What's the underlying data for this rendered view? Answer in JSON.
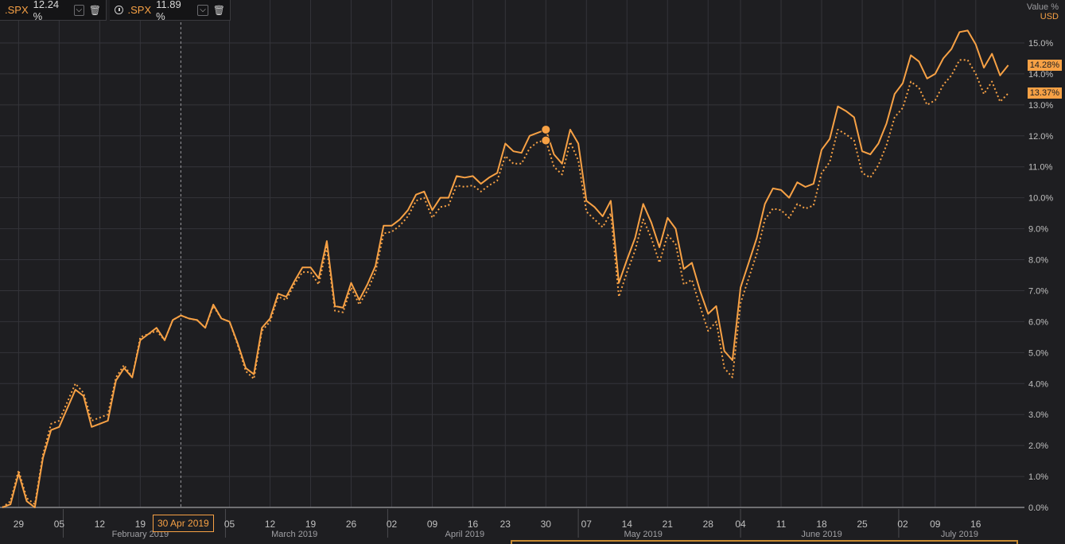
{
  "legend": [
    {
      "symbol": ".SPX",
      "value": "12.24 %",
      "clock": false
    },
    {
      "symbol": ".SPX",
      "value": "11.89 %",
      "clock": true
    }
  ],
  "axis": {
    "title": "Value %",
    "currency": "USD"
  },
  "tags": {
    "solid": "14.28%",
    "dotted": "13.37%"
  },
  "crosshair_date": "30 Apr 2019",
  "colors": {
    "line": "#f7a145",
    "background": "#1e1e21",
    "grid": "#34343a",
    "text": "#c0c0c0"
  },
  "chart_data": {
    "type": "line",
    "ylim": [
      0,
      16
    ],
    "yticks": [
      0,
      1,
      2,
      3,
      4,
      5,
      6,
      7,
      8,
      9,
      10,
      11,
      12,
      13,
      14,
      15
    ],
    "ytick_labels": [
      "0.0%",
      "1.0%",
      "2.0%",
      "3.0%",
      "4.0%",
      "5.0%",
      "6.0%",
      "7.0%",
      "8.0%",
      "9.0%",
      "10.0%",
      "11.0%",
      "12.0%",
      "13.0%",
      "14.0%",
      "15.0%"
    ],
    "xlim": [
      0,
      126
    ],
    "xticks": [
      {
        "i": 2,
        "label": "29"
      },
      {
        "i": 7,
        "label": "05"
      },
      {
        "i": 12,
        "label": "12"
      },
      {
        "i": 17,
        "label": "19"
      },
      {
        "i": 28,
        "label": "05"
      },
      {
        "i": 33,
        "label": "12"
      },
      {
        "i": 38,
        "label": "19"
      },
      {
        "i": 43,
        "label": "26"
      },
      {
        "i": 48,
        "label": "02"
      },
      {
        "i": 53,
        "label": "09"
      },
      {
        "i": 58,
        "label": "16"
      },
      {
        "i": 62,
        "label": "23"
      },
      {
        "i": 67,
        "label": "30"
      },
      {
        "i": 72,
        "label": "07"
      },
      {
        "i": 77,
        "label": "14"
      },
      {
        "i": 82,
        "label": "21"
      },
      {
        "i": 87,
        "label": "28"
      },
      {
        "i": 91,
        "label": "04"
      },
      {
        "i": 96,
        "label": "11"
      },
      {
        "i": 101,
        "label": "18"
      },
      {
        "i": 106,
        "label": "25"
      },
      {
        "i": 111,
        "label": "02"
      },
      {
        "i": 115,
        "label": "09"
      },
      {
        "i": 120,
        "label": "16"
      }
    ],
    "months": [
      {
        "label": "February 2019",
        "i": 17
      },
      {
        "label": "March 2019",
        "i": 36
      },
      {
        "label": "April 2019",
        "i": 57
      },
      {
        "label": "May 2019",
        "i": 79
      },
      {
        "label": "June 2019",
        "i": 101
      },
      {
        "label": "July 2019",
        "i": 118
      }
    ],
    "month_separators": [
      7.5,
      27.5,
      47.5,
      71,
      91,
      110.5
    ],
    "crosshair_index": 22,
    "marker_index": 67,
    "series": [
      {
        "style": "solid",
        "values": [
          0,
          0.1,
          1.1,
          0.2,
          0,
          1.6,
          2.5,
          2.6,
          3.2,
          3.8,
          3.6,
          2.6,
          2.7,
          2.8,
          4.1,
          4.5,
          4.2,
          5.4,
          5.6,
          5.8,
          5.4,
          6.05,
          6.2,
          6.1,
          6.05,
          5.8,
          6.55,
          6.1,
          6.0,
          5.3,
          4.5,
          4.3,
          5.8,
          6.1,
          6.9,
          6.8,
          7.3,
          7.75,
          7.75,
          7.4,
          8.6,
          6.5,
          6.45,
          7.25,
          6.7,
          7.2,
          7.8,
          9.1,
          9.1,
          9.3,
          9.6,
          10.1,
          10.2,
          9.6,
          10.0,
          10.0,
          10.7,
          10.65,
          10.7,
          10.45,
          10.65,
          10.8,
          11.75,
          11.5,
          11.45,
          12.0,
          12.1,
          12.2,
          11.4,
          11.1,
          12.2,
          11.75,
          9.9,
          9.7,
          9.4,
          9.9,
          7.25,
          8.0,
          8.7,
          9.8,
          9.2,
          8.4,
          9.35,
          9.0,
          7.7,
          7.9,
          7.0,
          6.25,
          6.5,
          5.05,
          4.75,
          7.1,
          7.9,
          8.7,
          9.8,
          10.3,
          10.25,
          10.0,
          10.5,
          10.35,
          10.45,
          11.55,
          11.9,
          12.95,
          12.8,
          12.6,
          11.5,
          11.4,
          11.75,
          12.4,
          13.35,
          13.7,
          14.6,
          14.4,
          13.85,
          14.0,
          14.5,
          14.8,
          15.35,
          15.4,
          14.95,
          14.2,
          14.65,
          13.95,
          14.28
        ]
      },
      {
        "style": "dotted",
        "values": [
          0,
          0.2,
          1.2,
          0.3,
          0.1,
          1.7,
          2.7,
          2.8,
          3.4,
          4.0,
          3.7,
          2.8,
          2.9,
          3.0,
          4.2,
          4.6,
          4.2,
          5.5,
          5.6,
          5.7,
          5.4,
          6.05,
          6.2,
          6.1,
          6.05,
          5.8,
          6.5,
          6.1,
          6.0,
          5.25,
          4.4,
          4.15,
          5.7,
          6.0,
          6.8,
          6.7,
          7.2,
          7.6,
          7.6,
          7.2,
          8.4,
          6.35,
          6.3,
          7.1,
          6.55,
          7.0,
          7.6,
          8.85,
          8.9,
          9.1,
          9.4,
          9.9,
          10.0,
          9.35,
          9.7,
          9.75,
          10.4,
          10.35,
          10.4,
          10.2,
          10.4,
          10.55,
          11.35,
          11.1,
          11.1,
          11.6,
          11.8,
          11.85,
          11.0,
          10.75,
          11.8,
          11.2,
          9.55,
          9.3,
          9.05,
          9.5,
          6.8,
          7.6,
          8.3,
          9.3,
          8.7,
          7.9,
          8.8,
          8.5,
          7.2,
          7.35,
          6.5,
          5.7,
          6.0,
          4.5,
          4.2,
          6.6,
          7.4,
          8.2,
          9.3,
          9.65,
          9.6,
          9.35,
          9.8,
          9.65,
          9.75,
          10.8,
          11.15,
          12.2,
          12.05,
          11.85,
          10.8,
          10.65,
          11.05,
          11.7,
          12.6,
          12.9,
          13.75,
          13.55,
          13.0,
          13.15,
          13.65,
          13.95,
          14.45,
          14.45,
          14.0,
          13.35,
          13.75,
          13.1,
          13.37
        ]
      }
    ]
  }
}
